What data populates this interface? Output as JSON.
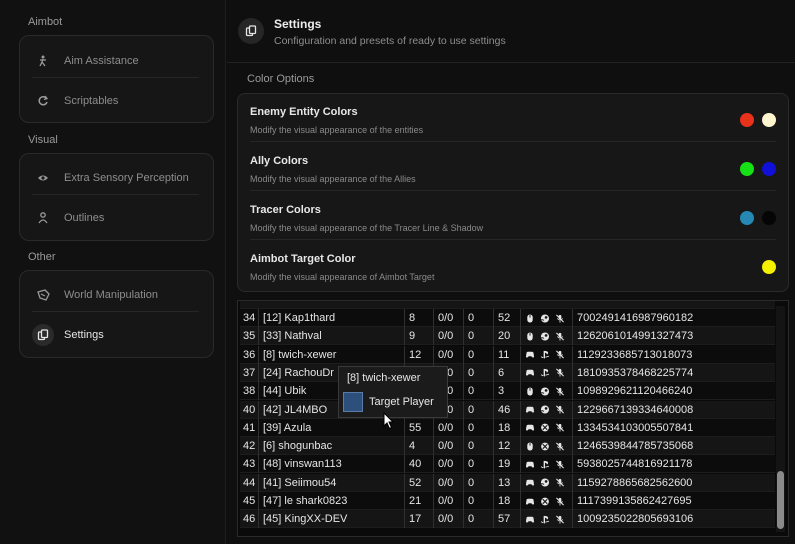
{
  "sidebar": {
    "sections": [
      {
        "title": "Aimbot",
        "items": [
          {
            "label": "Aim Assistance",
            "icon": "aim-person-icon"
          },
          {
            "label": "Scriptables",
            "icon": "refresh-icon"
          }
        ]
      },
      {
        "title": "Visual",
        "items": [
          {
            "label": "Extra Sensory Perception",
            "icon": "eye-icon"
          },
          {
            "label": "Outlines",
            "icon": "person-icon"
          }
        ]
      },
      {
        "title": "Other",
        "items": [
          {
            "label": "World Manipulation",
            "icon": "world-icon"
          },
          {
            "label": "Settings",
            "icon": "settings-copy-icon",
            "active": true
          }
        ]
      }
    ]
  },
  "header": {
    "title": "Settings",
    "subtitle": "Configuration and presets of ready to use settings"
  },
  "color_options": {
    "label": "Color Options",
    "rows": [
      {
        "title": "Enemy Entity Colors",
        "desc": "Modify the visual appearance of the entities",
        "colors": [
          "#e8321b",
          "#fff6d0"
        ]
      },
      {
        "title": "Ally Colors",
        "desc": "Modify the visual appearance of the Allies",
        "colors": [
          "#16e016",
          "#1010d8"
        ]
      },
      {
        "title": "Tracer Colors",
        "desc": "Modify the visual appearance of the Tracer Line & Shadow",
        "colors": [
          "#2589b4",
          "#050505"
        ]
      },
      {
        "title": "Aimbot Target Color",
        "desc": "Modify the visual appearance of Aimbot Target",
        "colors": [
          "#f4f000"
        ]
      }
    ]
  },
  "players": {
    "rows": [
      {
        "idx": "34",
        "name": "[12] Kap1thard",
        "c2": "8",
        "c3": "0/0",
        "c4": "0",
        "c5": "52",
        "platform": [
          "mouse",
          "steam",
          "mic-off"
        ],
        "id": "7002491416987960182"
      },
      {
        "idx": "35",
        "name": "[33] Nathval",
        "c2": "9",
        "c3": "0/0",
        "c4": "0",
        "c5": "20",
        "platform": [
          "mouse",
          "steam",
          "mic-off"
        ],
        "id": "1262061014991327473"
      },
      {
        "idx": "36",
        "name": "[8] twich-xewer",
        "c2": "12",
        "c3": "0/0",
        "c4": "0",
        "c5": "11",
        "platform": [
          "gamepad",
          "playstation",
          "mic-off"
        ],
        "id": "1129233685713018073"
      },
      {
        "idx": "37",
        "name": "[24] RachouDr",
        "c2": "",
        "c3": "0/0",
        "c4": "0",
        "c5": "6",
        "platform": [
          "gamepad",
          "playstation",
          "mic-off"
        ],
        "id": "1810935378468225774"
      },
      {
        "idx": "38",
        "name": "[44] Ubik",
        "c2": "",
        "c3": "0/0",
        "c4": "0",
        "c5": "3",
        "platform": [
          "mouse",
          "steam",
          "mic-off"
        ],
        "id": "1098929621120466240"
      },
      {
        "idx": "40",
        "name": "[42] JL4MBO",
        "c2": "",
        "c3": "0/0",
        "c4": "0",
        "c5": "46",
        "platform": [
          "gamepad",
          "steam",
          "mic-off"
        ],
        "id": "1229667139334640008"
      },
      {
        "idx": "41",
        "name": "[39] Azula",
        "c2": "55",
        "c3": "0/0",
        "c4": "0",
        "c5": "18",
        "platform": [
          "gamepad",
          "xbox",
          "mic-off"
        ],
        "id": "1334534103005507841"
      },
      {
        "idx": "42",
        "name": "[6] shogunbac",
        "c2": "4",
        "c3": "0/0",
        "c4": "0",
        "c5": "12",
        "platform": [
          "mouse",
          "xbox",
          "mic-off"
        ],
        "id": "1246539844785735068"
      },
      {
        "idx": "43",
        "name": "[48] vinswan113",
        "c2": "40",
        "c3": "0/0",
        "c4": "0",
        "c5": "19",
        "platform": [
          "gamepad",
          "playstation",
          "mic-off"
        ],
        "id": "5938025744816921178"
      },
      {
        "idx": "44",
        "name": "[41] Seiimou54",
        "c2": "52",
        "c3": "0/0",
        "c4": "0",
        "c5": "13",
        "platform": [
          "gamepad",
          "steam",
          "mic-off"
        ],
        "id": "1159278865682562600"
      },
      {
        "idx": "45",
        "name": "[47] le shark0823",
        "c2": "21",
        "c3": "0/0",
        "c4": "0",
        "c5": "18",
        "platform": [
          "gamepad",
          "xbox",
          "mic-off"
        ],
        "id": "1117399135862427695"
      },
      {
        "idx": "46",
        "name": "[45] KingXX-DEV",
        "c2": "17",
        "c3": "0/0",
        "c4": "0",
        "c5": "57",
        "platform": [
          "gamepad",
          "playstation",
          "mic-off"
        ],
        "id": "1009235022805693106"
      }
    ]
  },
  "context_menu": {
    "title": "[8] twich-xewer",
    "item": "Target Player",
    "item_color": "#2d4f7c"
  }
}
